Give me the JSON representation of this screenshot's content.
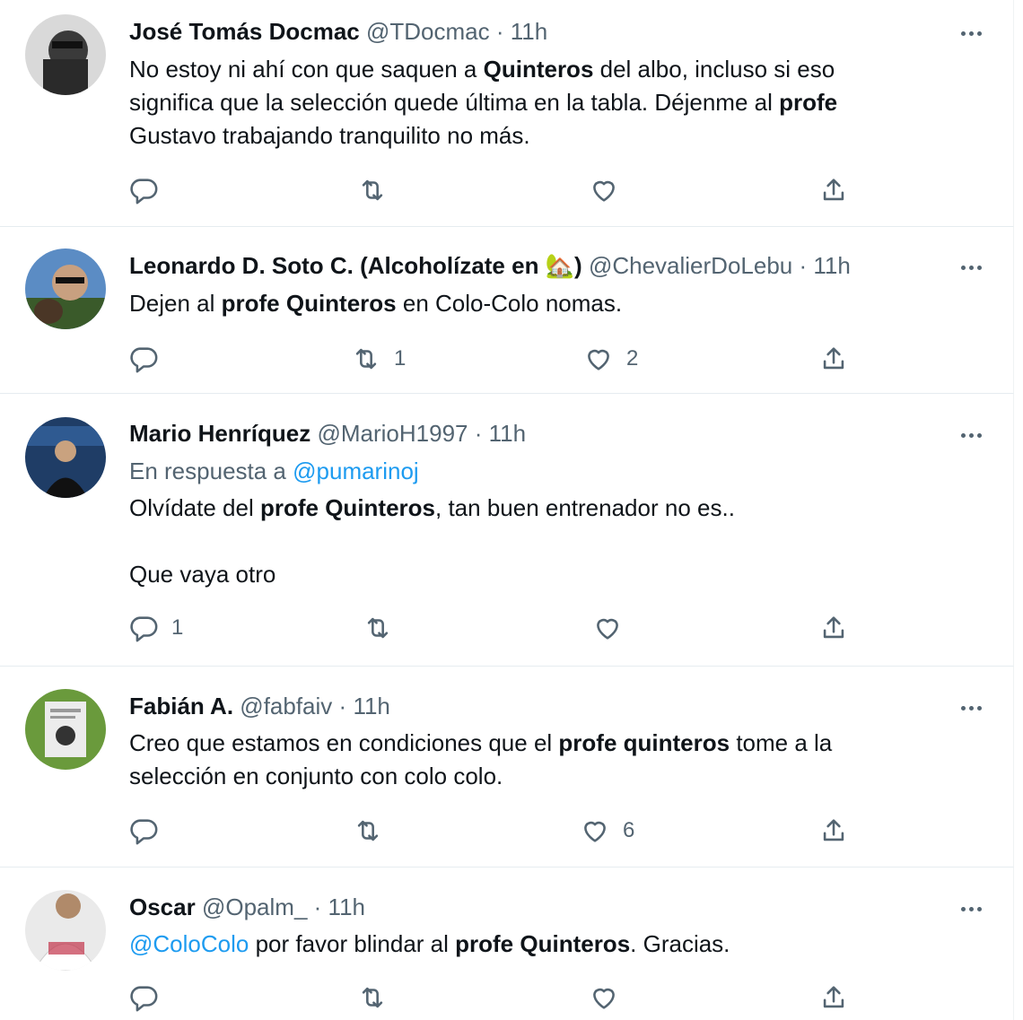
{
  "tweets": [
    {
      "name": "José Tomás Docmac",
      "handle": "@TDocmac",
      "time": "11h",
      "text_segments": [
        [
          "No estoy ni ahí con que saquen a ",
          "plain"
        ],
        [
          "Quinteros",
          "bold"
        ],
        [
          " del albo, incluso si eso significa que la selección quede última en la tabla. Déjenme al ",
          "plain"
        ],
        [
          "profe",
          "bold"
        ],
        [
          " Gustavo trabajando tranquilito no más.",
          "plain"
        ]
      ],
      "replies": "",
      "retweets": "",
      "likes": ""
    },
    {
      "name": "Leonardo D. Soto C. (Alcoholízate en 🏡)",
      "handle": "@ChevalierDoLebu",
      "time": "11h",
      "text_segments": [
        [
          "Dejen al ",
          "plain"
        ],
        [
          "profe Quinteros",
          "bold"
        ],
        [
          " en Colo-Colo nomas.",
          "plain"
        ]
      ],
      "replies": "",
      "retweets": "1",
      "likes": "2"
    },
    {
      "name": "Mario Henríquez",
      "handle": "@MarioH1997",
      "time": "11h",
      "reply_prefix": "En respuesta a ",
      "reply_to": "@pumarinoj",
      "text_segments": [
        [
          "Olvídate del ",
          "plain"
        ],
        [
          "profe Quinteros",
          "bold"
        ],
        [
          ", tan buen entrenador no es..",
          "plain"
        ]
      ],
      "second_paragraph": "Que vaya otro",
      "replies": "1",
      "retweets": "",
      "likes": ""
    },
    {
      "name": "Fabián A.",
      "handle": "@fabfaiv",
      "time": "11h",
      "text_segments": [
        [
          "Creo que estamos en condiciones que el ",
          "plain"
        ],
        [
          "profe quinteros",
          "bold"
        ],
        [
          " tome a la selección en conjunto con colo colo.",
          "plain"
        ]
      ],
      "replies": "",
      "retweets": "",
      "likes": "6"
    },
    {
      "name": "Oscar",
      "handle": "@Opalm_",
      "time": "11h",
      "text_segments": [
        [
          "@ColoColo",
          "mention"
        ],
        [
          " por favor blindar al ",
          "plain"
        ],
        [
          "profe Quinteros",
          "bold"
        ],
        [
          ". Gracias.",
          "plain"
        ]
      ],
      "replies": "",
      "retweets": "",
      "likes": ""
    }
  ],
  "separator": "·",
  "icons": {
    "reply": "reply-icon",
    "retweet": "retweet-icon",
    "like": "heart-icon",
    "share": "share-icon",
    "more": "more-options-icon"
  },
  "colors": {
    "text": "#0f1419",
    "secondary": "#536471",
    "link": "#1d9bf0",
    "divider": "#e6ecf0"
  }
}
